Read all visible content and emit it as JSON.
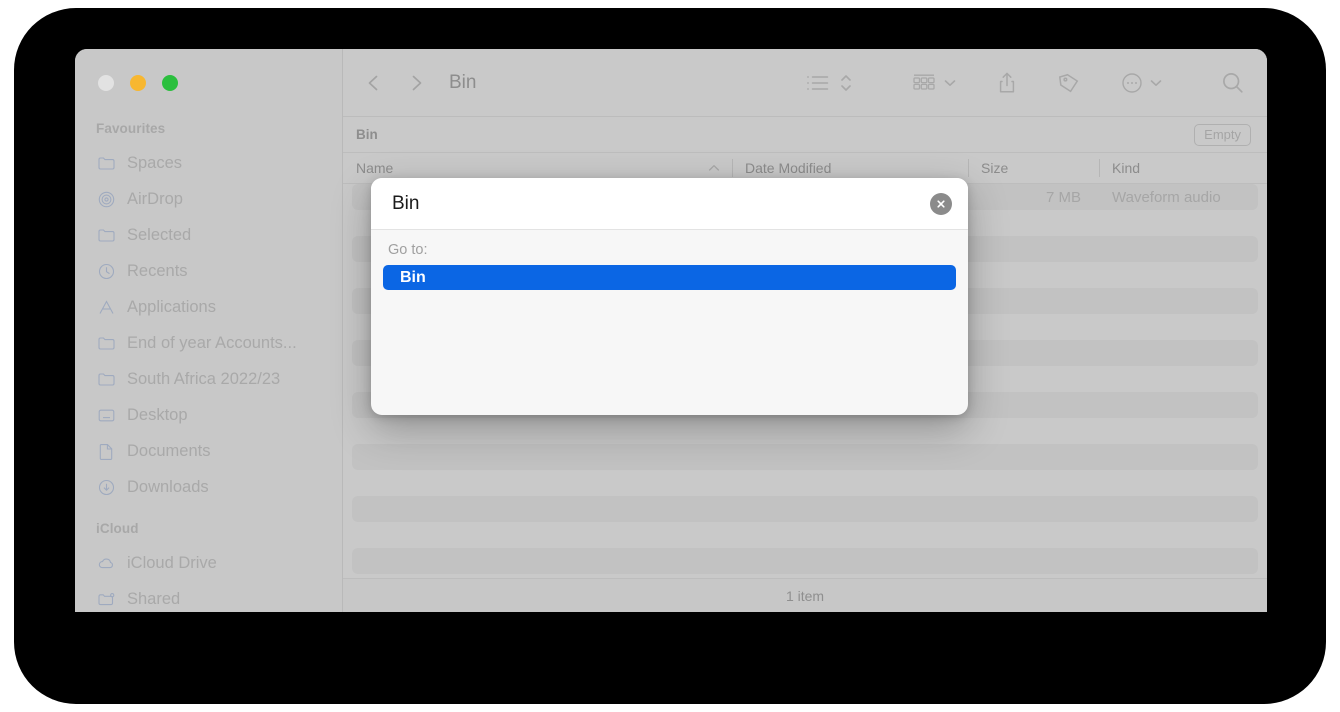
{
  "window": {
    "traffic_lights": [
      {
        "name": "close",
        "color": "#e2e2e2"
      },
      {
        "name": "minimize",
        "color": "#f7b731"
      },
      {
        "name": "maximize",
        "color": "#2bbf3e"
      }
    ]
  },
  "sidebar": {
    "groups": [
      {
        "label": "Favourites",
        "items": [
          {
            "label": "Spaces",
            "icon": "folder-icon"
          },
          {
            "label": "AirDrop",
            "icon": "airdrop-icon"
          },
          {
            "label": "Selected",
            "icon": "folder-icon"
          },
          {
            "label": "Recents",
            "icon": "clock-icon"
          },
          {
            "label": "Applications",
            "icon": "applications-icon"
          },
          {
            "label": "End of year Accounts...",
            "icon": "folder-icon"
          },
          {
            "label": "South Africa 2022/23",
            "icon": "folder-icon"
          },
          {
            "label": "Desktop",
            "icon": "desktop-icon"
          },
          {
            "label": "Documents",
            "icon": "document-icon"
          },
          {
            "label": "Downloads",
            "icon": "downloads-icon"
          }
        ]
      },
      {
        "label": "iCloud",
        "items": [
          {
            "label": "iCloud Drive",
            "icon": "cloud-icon"
          },
          {
            "label": "Shared",
            "icon": "shared-folder-icon"
          }
        ]
      }
    ]
  },
  "toolbar": {
    "back_icon": "chevron-left-icon",
    "forward_icon": "chevron-right-icon",
    "title": "Bin",
    "buttons": [
      {
        "name": "view-list-button",
        "icon": "list-view-icon"
      },
      {
        "name": "sort-button",
        "icon": "sort-updown-icon"
      },
      {
        "name": "group-by-button",
        "icon": "grid-group-icon"
      },
      {
        "name": "group-by-chevron",
        "icon": "chevron-down-icon"
      },
      {
        "name": "share-button",
        "icon": "share-icon"
      },
      {
        "name": "tag-button",
        "icon": "tag-icon"
      },
      {
        "name": "more-button",
        "icon": "ellipsis-circle-icon"
      },
      {
        "name": "more-chevron",
        "icon": "chevron-down-icon"
      },
      {
        "name": "search-button",
        "icon": "search-icon"
      }
    ]
  },
  "path_bar": {
    "label": "Bin",
    "empty_button": "Empty"
  },
  "columns": [
    {
      "key": "name",
      "label": "Name",
      "sorted": true,
      "sort_direction": "ascending"
    },
    {
      "key": "date",
      "label": "Date Modified",
      "sorted": false
    },
    {
      "key": "size",
      "label": "Size",
      "sorted": false
    },
    {
      "key": "kind",
      "label": "Kind",
      "sorted": false
    }
  ],
  "files": [
    {
      "name": "",
      "date": "",
      "size": "7 MB",
      "kind": "Waveform audio"
    }
  ],
  "status": {
    "item_count": "1 item"
  },
  "dialog": {
    "name": "go-to-folder-dialog",
    "input_value": "Bin",
    "clear_icon": "close-circle-icon",
    "section_label": "Go to:",
    "results": [
      {
        "label": "Bin",
        "selected": true
      }
    ],
    "accent_color": "#0b66e4"
  }
}
